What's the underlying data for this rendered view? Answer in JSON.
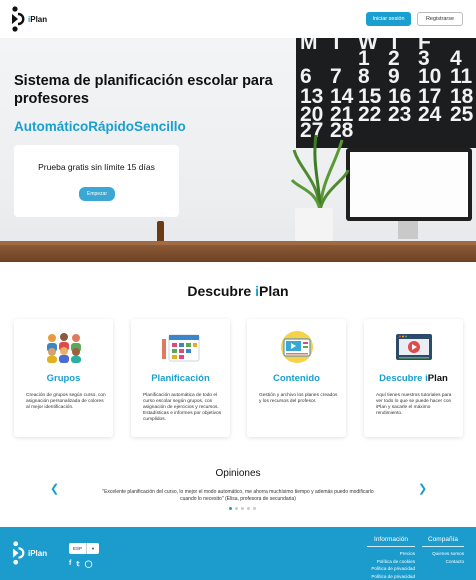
{
  "header": {
    "logo_text": "Plan",
    "logo_prefix": "i",
    "login_label": "Iniciar sesión",
    "register_label": "Registrarse"
  },
  "hero": {
    "title": "Sistema de planificación escolar para profesores",
    "slogans": [
      "Automático",
      "Rápido",
      "Sencillo"
    ],
    "trial_text": "Prueba gratis sin límite 15 días",
    "start_label": "Empezar"
  },
  "discover": {
    "title_prefix": "Descubre ",
    "title_i": "i",
    "title_rest": "Plan",
    "features": [
      {
        "title": "Grupos",
        "icon": "group-icon",
        "desc": "Creación de grupos según curso, con asignación personalizada de colores al mejor identificación."
      },
      {
        "title": "Planificación",
        "icon": "calendar-icon",
        "desc": "Planificación automática de todo el curso escolar según grupos, con asignación de ejercicios y recursos. Estadísticas e informes por objetivos cumplidos."
      },
      {
        "title": "Contenido",
        "icon": "video-content-icon",
        "desc": "Gestión y archivo los planes creados y los recursos del profesor."
      },
      {
        "title_prefix": "Descubre ",
        "title_i": "i",
        "title_rest": "Plan",
        "icon": "video-player-icon",
        "desc": "Aquí tienes nuestros tutoriales para ver todo lo que se puede hacer con iPlan y sacarle el máximo rendimiento."
      }
    ]
  },
  "opinions": {
    "title": "Opiniones",
    "quote": "\"Excelente planificación del curso, lo mejor el modo automático, me ahorra muchísimo tiempo y además puedo modificarlo cuando lo necesito\" (Elisa, profesora de secundaria)",
    "prev_icon": "chevron-left-icon",
    "next_icon": "chevron-right-icon"
  },
  "footer": {
    "logo_text": "iPlan",
    "language_value": "ESP",
    "info_heading": "Información",
    "info_links": [
      "Precios",
      "Política de cookies",
      "Política de privacidad",
      "Política de privacidad"
    ],
    "company_heading": "Compañía",
    "company_links": [
      "Quienes somos",
      "Contacto"
    ],
    "social_icons": [
      "facebook-icon",
      "twitter-icon",
      "instagram-icon"
    ]
  },
  "colors": {
    "accent": "#1a9fd1",
    "footer_bg": "#1b9ccd"
  }
}
